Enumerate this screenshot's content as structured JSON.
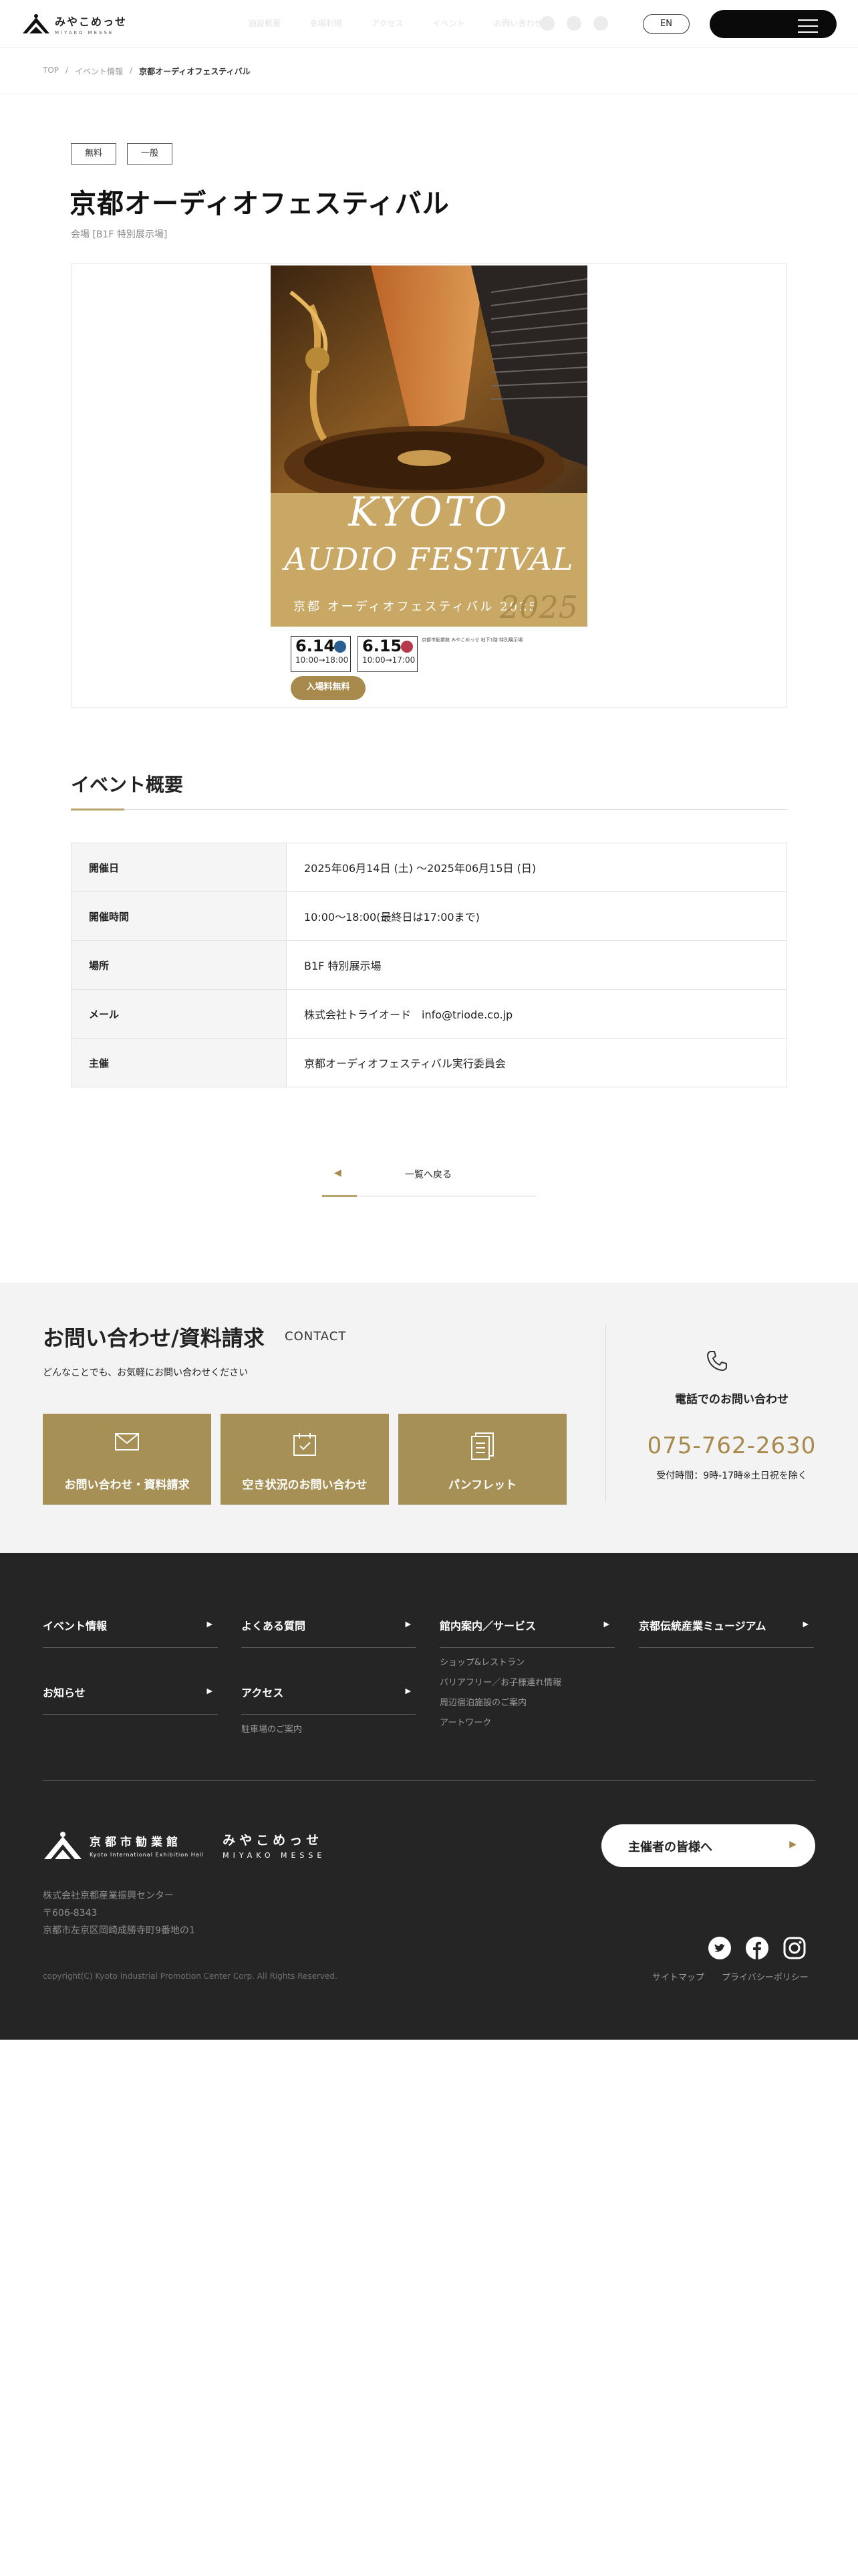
{
  "header": {
    "logo_jp": "みやこめっせ",
    "logo_en": "MIYAKO MESSE",
    "nav": [
      "施設概要",
      "会場利用",
      "アクセス",
      "イベント",
      "お問い合わせ"
    ],
    "lang_label": "EN"
  },
  "breadcrumb": {
    "items": [
      "TOP",
      "イベント情報"
    ],
    "current": "京都オーディオフェスティバル"
  },
  "event": {
    "tags": [
      "無料",
      "一般"
    ],
    "title": "京都オーディオフェスティバル",
    "venue": "会場 [B1F 特別展示場]"
  },
  "poster": {
    "title_line1": "KYOTO",
    "title_line2": "AUDIO FESTIVAL",
    "title_jp": "京都 オーディオフェスティバル 2025",
    "year": "2025",
    "dates": [
      {
        "date": "6.14",
        "hours": "10:00→18:00",
        "dot_color": "#2b5f8f"
      },
      {
        "date": "6.15",
        "hours": "10:00→17:00",
        "dot_color": "#b73a4a"
      }
    ],
    "free_label": "入場料無料",
    "small_text": "京都市勧業館 みやこめっせ 地下1階 特別展示場"
  },
  "overview": {
    "title": "イベント概要",
    "rows": [
      {
        "label": "開催日",
        "value": "2025年06月14日 (土) 〜2025年06月15日 (日)"
      },
      {
        "label": "開催時間",
        "value": "10:00〜18:00(最終日は17:00まで)"
      },
      {
        "label": "場所",
        "value": "B1F 特別展示場"
      },
      {
        "label": "メール",
        "value": "株式会社トライオード　info@triode.co.jp"
      },
      {
        "label": "主催",
        "value": "京都オーディオフェスティバル実行委員会"
      }
    ]
  },
  "back": {
    "arrow": "◀",
    "label": "一覧へ戻る"
  },
  "contact": {
    "title": "お問い合わせ/資料請求",
    "subtitle": "CONTACT",
    "description": "どんなことでも、お気軽にお問い合わせください",
    "buttons": [
      {
        "label": "お問い合わせ・資料請求",
        "icon": "mail-icon"
      },
      {
        "label": "空き状況のお問い合わせ",
        "icon": "calendar-check-icon"
      },
      {
        "label": "パンフレット",
        "icon": "document-icon"
      }
    ],
    "phone_label": "電話でのお問い合わせ",
    "phone_number": "075-762-2630",
    "phone_hours": "受付時間：9時-17時※土日祝を除く"
  },
  "footer": {
    "columns": [
      {
        "title": "イベント情報",
        "subs": []
      },
      {
        "title": "よくある質問",
        "subs": []
      },
      {
        "title": "館内案内／サービス",
        "subs": [
          "ショップ&レストラン",
          "バリアフリー／お子様連れ情報",
          "周辺宿泊施設のご案内",
          "アートワーク"
        ]
      },
      {
        "title": "京都伝統産業ミュージアム",
        "subs": []
      },
      {
        "title": "お知らせ",
        "subs": []
      },
      {
        "title": "アクセス",
        "subs": [
          "駐車場のご案内"
        ]
      }
    ],
    "arrow": "▶",
    "logo_jp": "京都市勧業館",
    "logo_en": "Kyoto International Exhibition Hall",
    "brand_jp": "みやこめっせ",
    "brand_en": "MIYAKO MESSE",
    "address": [
      "株式会社京都産業振興センター",
      "〒606-8343",
      "京都市左京区岡崎成勝寺町9番地の1"
    ],
    "organizer_label": "主催者の皆様へ",
    "organizer_arrow": "▶",
    "links": [
      "サイトマップ",
      "プライバシーポリシー"
    ],
    "copyright": "copyright(C) Kyoto Industrial Promotion Center Corp. All Rights Reserved."
  },
  "colors": {
    "accent_gold": "#a88a4c",
    "button_gold": "#a69055",
    "footer_bg": "#252525"
  }
}
